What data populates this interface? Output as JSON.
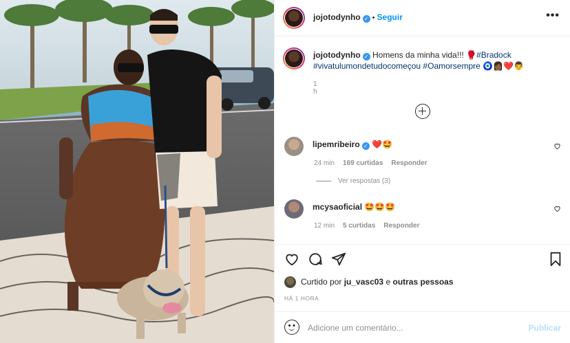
{
  "post": {
    "author": "jojotodynho",
    "follow_label": "Seguir",
    "more_label": "•••",
    "caption_user": "jojotodynho",
    "caption_text": "Homens da minha vida!!! 🥊",
    "hashtags_line1": "#Bradock",
    "hashtags_line2": "#vivatulumondetudocomeçou #Oamorsempre",
    "caption_emojis": "🧿👩🏾‍❤️‍👨",
    "caption_time": "1 h"
  },
  "comments": [
    {
      "user": "lipemribeiro",
      "text": "❤️🤩",
      "time": "24 min",
      "likes": "169 curtidas",
      "reply": "Responder",
      "avatar_color": "#9a8f86"
    },
    {
      "user": "mcysaoficial",
      "text": "🤩🤩🤩",
      "time": "12 min",
      "likes": "5 curtidas",
      "reply": "Responder",
      "avatar_color": "#6f6a78"
    }
  ],
  "view_replies": "Ver respostas (3)",
  "liked_by": {
    "prefix": "Curtido por",
    "user": "ju_vasc03",
    "connector": "e",
    "others": "outras pessoas"
  },
  "time_ago": "HÁ 1 HORA",
  "add_comment": {
    "placeholder": "Adicione um comentário...",
    "publish": "Publicar"
  },
  "colors": {
    "accent": "#0095f6",
    "verified": "#3897f0",
    "muted": "#8e8e8e",
    "publish_disabled": "#b2dffc"
  }
}
